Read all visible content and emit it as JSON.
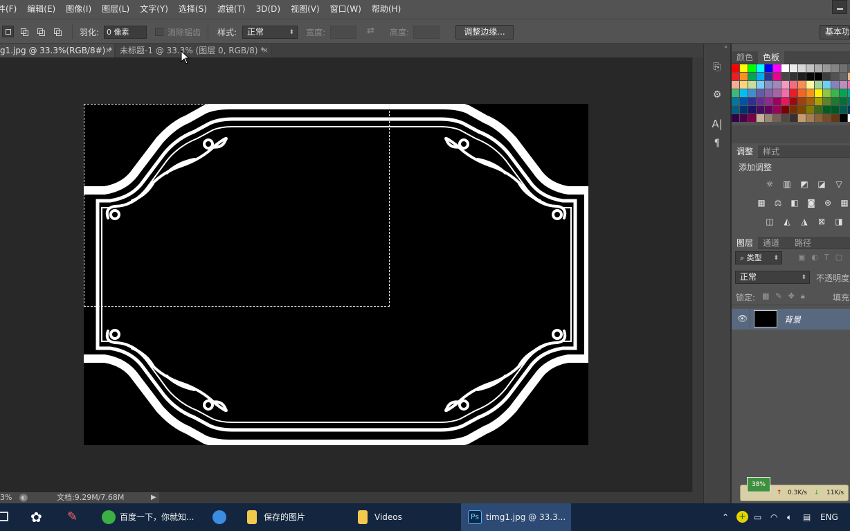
{
  "menu": [
    "件(F)",
    "编辑(E)",
    "图像(I)",
    "图层(L)",
    "文字(Y)",
    "选择(S)",
    "滤镜(T)",
    "3D(D)",
    "视图(V)",
    "窗口(W)",
    "帮助(H)"
  ],
  "options": {
    "feather_label": "羽化:",
    "feather_value": "0 像素",
    "antialias_label": "消除锯齿",
    "style_label": "样式:",
    "style_value": "正常",
    "width_label": "宽度:",
    "height_label": "高度:",
    "refine_edge_button": "调整边缘...",
    "workspace_button": "基本功"
  },
  "tabs": [
    {
      "label": "g1.jpg @ 33.3%(RGB/8#) *",
      "active": true
    },
    {
      "label": "未标题-1 @ 33.3% (图层 0, RGB/8) *",
      "active": false
    }
  ],
  "status": {
    "zoom": "3%",
    "doc_size": "文档:9.29M/7.68M"
  },
  "panels": {
    "color_tabs": [
      "颜色",
      "色板"
    ],
    "adjust_tabs": [
      "调整",
      "样式"
    ],
    "add_adjustment": "添加调整",
    "layer_tabs": [
      "图层",
      "通道",
      "路径"
    ],
    "kind_filter": "类型",
    "blend_mode": "正常",
    "opacity_label": "不透明度",
    "lock_label": "锁定:",
    "fill_label": "填充",
    "layer_name": "背景"
  },
  "swatch_rows": [
    [
      "#ff0000",
      "#ffff00",
      "#00ff00",
      "#00ffff",
      "#0000ff",
      "#ff00ff",
      "#ffffff",
      "#ebebeb",
      "#d6d6d6",
      "#c2c2c2",
      "#adadad",
      "#999999",
      "#858585",
      "#707070",
      "#5c5c5c"
    ],
    [
      "#ee1c24",
      "#f7941d",
      "#00a651",
      "#00aeef",
      "#2e3192",
      "#ec008c",
      "#474747",
      "#333333",
      "#1f1f1f",
      "#0a0a0a",
      "#000000",
      "#3d3d3d",
      "#525252",
      "#666666",
      "#ffb680"
    ],
    [
      "#f4ae8f",
      "#fdd281",
      "#c4df9b",
      "#7ccdf3",
      "#8393ca",
      "#a187be",
      "#f49ac1",
      "#f26d7d",
      "#f68e55",
      "#fff79a",
      "#a3d39c",
      "#6dcff6",
      "#8781bd",
      "#bd8cbf",
      "#f06eaa"
    ],
    [
      "#3cb878",
      "#00bff3",
      "#448ccb",
      "#605ca8",
      "#855fa8",
      "#a863a8",
      "#f06eaa",
      "#ed1c24",
      "#f26522",
      "#f7941d",
      "#fff200",
      "#8dc63f",
      "#39b54a",
      "#00a651",
      "#00a99d"
    ],
    [
      "#0076a3",
      "#0054a6",
      "#2e3192",
      "#662d91",
      "#92278f",
      "#9e005d",
      "#ed145b",
      "#9e0b0f",
      "#a0410d",
      "#a36209",
      "#aba000",
      "#598527",
      "#197b30",
      "#007236",
      "#00746b"
    ],
    [
      "#005e7f",
      "#003471",
      "#1b1464",
      "#440e62",
      "#630460",
      "#9e005d",
      "#790000",
      "#7b2e00",
      "#7d4900",
      "#827b00",
      "#406618",
      "#005e20",
      "#005826",
      "#005952",
      "#003663"
    ],
    [
      "#32004b",
      "#4b0049",
      "#7b0046",
      "#c7b299",
      "#998675",
      "#736357",
      "#534741",
      "#37302d",
      "#c69c6d",
      "#a67c52",
      "#8c6239",
      "#754c24",
      "#603913",
      "#000000",
      "#ffffff"
    ]
  ],
  "taskbar": {
    "items": [
      "百度一下，你就知...",
      "保存的图片",
      "Videos",
      "timg1.jpg @ 33.3..."
    ],
    "lang": "ENG"
  },
  "netmon": {
    "badge": "38%",
    "up": "0.3K/s",
    "down": "11K/s"
  }
}
